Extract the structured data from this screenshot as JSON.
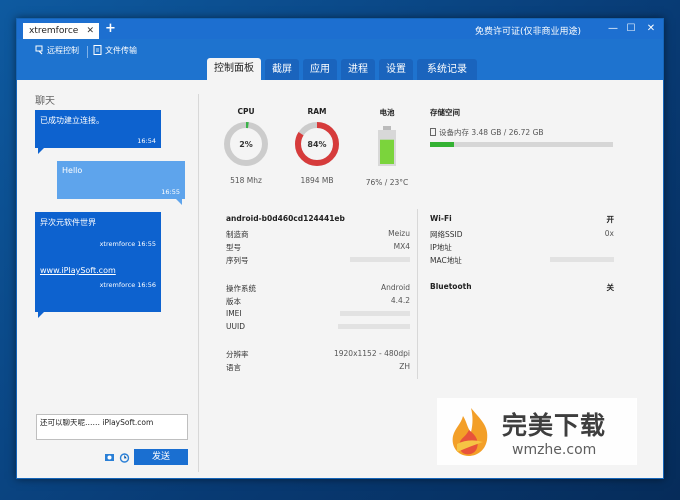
{
  "window": {
    "tab_title": "xtremforce",
    "tab_close": "✕",
    "new_tab": "+",
    "license_text": "免费许可证(仅非商业用途)",
    "minimize": "—",
    "maximize": "☐",
    "close": "✕"
  },
  "toolbar": {
    "remote_control": "远程控制",
    "file_transfer": "文件传输"
  },
  "nav_tabs": [
    {
      "label": "控制面板",
      "active": true
    },
    {
      "label": "截屏",
      "active": false
    },
    {
      "label": "应用",
      "active": false
    },
    {
      "label": "进程",
      "active": false
    },
    {
      "label": "设置",
      "active": false
    },
    {
      "label": "系统记录",
      "active": false
    }
  ],
  "chat": {
    "title": "聊天",
    "messages": [
      {
        "text": "已成功建立连接。",
        "meta": "16:54",
        "dir": "in"
      },
      {
        "text": "Hello",
        "meta": "16:55",
        "dir": "out"
      },
      {
        "text": "异次元软件世界",
        "meta": "xtremforce 16:55",
        "dir": "in"
      },
      {
        "text": "www.iPlaySoft.com",
        "meta": "xtremforce 16:56",
        "dir": "in"
      }
    ],
    "input_value": "还可以聊天呢…… iPlaySoft.com",
    "send_label": "发送"
  },
  "stats": {
    "cpu": {
      "label": "CPU",
      "value": "2%",
      "percent": 2,
      "sub": "518 Mhz",
      "color": "#3ab34a"
    },
    "ram": {
      "label": "RAM",
      "value": "84%",
      "percent": 84,
      "sub": "1894 MB",
      "color": "#d63b3b"
    },
    "battery": {
      "label": "电池",
      "sub": "76% / 23°C",
      "percent": 76,
      "color": "#7bd43c"
    },
    "storage": {
      "label": "存储空间",
      "row": "设备内存 3.48 GB / 26.72 GB",
      "used_fraction": 0.13,
      "color": "#34b233"
    }
  },
  "device": {
    "name": "android-b0d460cd124441eb",
    "rows": [
      {
        "k": "制造商",
        "v": "Meizu"
      },
      {
        "k": "型号",
        "v": "MX4"
      },
      {
        "k": "序列号",
        "v": ""
      }
    ],
    "os_rows": [
      {
        "k": "操作系统",
        "v": "Android"
      },
      {
        "k": "版本",
        "v": "4.4.2"
      },
      {
        "k": "IMEI",
        "v": ""
      },
      {
        "k": "UUID",
        "v": ""
      }
    ],
    "display_rows": [
      {
        "k": "分辨率",
        "v": "1920x1152 - 480dpi"
      },
      {
        "k": "语言",
        "v": "ZH"
      }
    ]
  },
  "network": {
    "wifi": {
      "k": "Wi-Fi",
      "v": "开"
    },
    "wifi_rows": [
      {
        "k": "网络SSID",
        "v": "0x"
      },
      {
        "k": "IP地址",
        "v": ""
      },
      {
        "k": "MAC地址",
        "v": ""
      }
    ],
    "bluetooth": {
      "k": "Bluetooth",
      "v": "关"
    }
  },
  "watermark": {
    "cn": "完美下载",
    "en": "wmzhe.com"
  }
}
